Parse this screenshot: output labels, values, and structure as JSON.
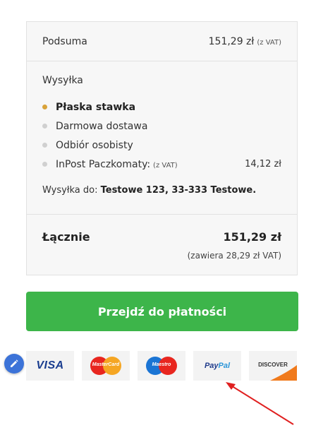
{
  "summary": {
    "subtotal_label": "Podsuma",
    "subtotal_value": "151,29 zł",
    "subtotal_vat": "(z VAT)",
    "shipping_title": "Wysyłka",
    "options": [
      {
        "label": "Płaska stawka",
        "selected": true,
        "price": "",
        "vat": ""
      },
      {
        "label": "Darmowa dostawa",
        "selected": false,
        "price": "",
        "vat": ""
      },
      {
        "label": "Odbiór osobisty",
        "selected": false,
        "price": "",
        "vat": ""
      },
      {
        "label": "InPost Paczkomaty:",
        "selected": false,
        "price": "14,12 zł",
        "vat": "(z VAT)"
      }
    ],
    "ship_to_label": "Wysyłka do:",
    "ship_to_address": "Testowe 123, 33-333 Testowe.",
    "total_label": "Łącznie",
    "total_value": "151,29 zł",
    "total_vat_note": "(zawiera 28,29 zł VAT)"
  },
  "checkout": {
    "button_label": "Przejdź do płatności",
    "color": "#3db54a"
  },
  "payment_cards": {
    "visa": "VISA",
    "mastercard": "MasterCard",
    "maestro": "Maestro",
    "paypal": "PayPal",
    "discover": "DISCOVER"
  },
  "colors": {
    "selected_bullet": "#d9a33a",
    "edit_fab": "#3c73d8",
    "annotation_arrow": "#e02020"
  },
  "icons": {
    "edit_fab": "pencil-icon",
    "annotation": "arrow-annotation"
  }
}
